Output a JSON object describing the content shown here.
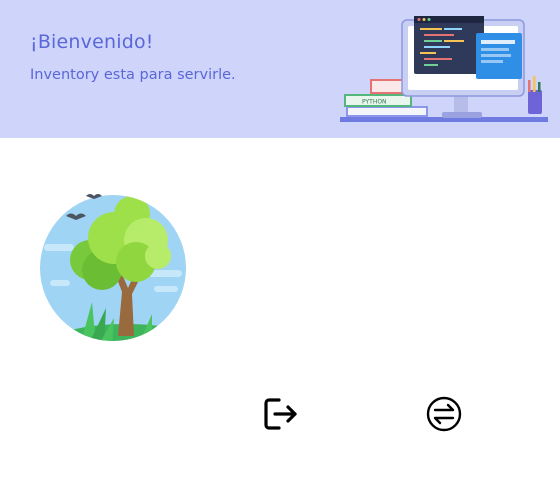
{
  "banner": {
    "title": "¡Bienvenido!",
    "subtitle": "Inventory esta para servirle.",
    "book_label": "PYTHON",
    "background_color": "#cfd4fb",
    "accent_color": "#5a67d8"
  },
  "profile": {
    "avatar_icon": "tree-landscape-illustration"
  },
  "actions": {
    "logout_icon": "logout-icon",
    "switch_icon": "switch-arrows-icon"
  }
}
